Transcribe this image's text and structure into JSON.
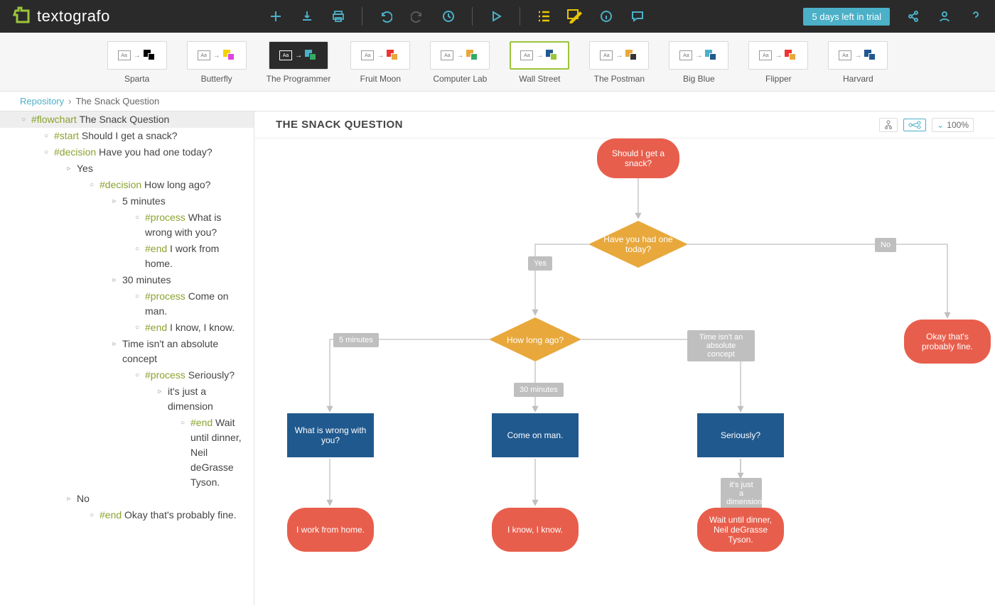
{
  "app": {
    "name": "textografo",
    "trial": "5 days left in trial"
  },
  "themes": [
    {
      "id": "sparta",
      "label": "Sparta"
    },
    {
      "id": "butterfly",
      "label": "Butterfly"
    },
    {
      "id": "programmer",
      "label": "The Programmer"
    },
    {
      "id": "fruitmoon",
      "label": "Fruit Moon"
    },
    {
      "id": "computerlab",
      "label": "Computer Lab"
    },
    {
      "id": "wallstreet",
      "label": "Wall Street",
      "selected": true
    },
    {
      "id": "postman",
      "label": "The Postman"
    },
    {
      "id": "bigblue",
      "label": "Big Blue"
    },
    {
      "id": "flipper",
      "label": "Flipper"
    },
    {
      "id": "harvard",
      "label": "Harvard"
    }
  ],
  "breadcrumb": {
    "root": "Repository",
    "current": "The Snack Question"
  },
  "canvas": {
    "title": "THE SNACK QUESTION",
    "zoom": "100%"
  },
  "tree": {
    "root": {
      "tag": "#flowchart",
      "text": "The Snack Question"
    },
    "lines": [
      {
        "indent": 1,
        "marker": "circle",
        "tag": "#start",
        "text": "Should I get a snack?"
      },
      {
        "indent": 1,
        "marker": "circle",
        "tag": "#decision",
        "text": "Have you had one today?"
      },
      {
        "indent": 2,
        "marker": "arrow",
        "text": "Yes"
      },
      {
        "indent": 3,
        "marker": "circle",
        "tag": "#decision",
        "text": "How long ago?"
      },
      {
        "indent": 4,
        "marker": "arrow",
        "text": "5 minutes"
      },
      {
        "indent": 5,
        "marker": "circle",
        "tag": "#process",
        "text": " What is wrong with you?"
      },
      {
        "indent": 5,
        "marker": "circle",
        "tag": "#end",
        "text": "I work from home."
      },
      {
        "indent": 4,
        "marker": "arrow",
        "text": "30 minutes"
      },
      {
        "indent": 5,
        "marker": "circle",
        "tag": "#process",
        "text": "Come on man."
      },
      {
        "indent": 5,
        "marker": "circle",
        "tag": "#end",
        "text": "I know, I know."
      },
      {
        "indent": 4,
        "marker": "arrow",
        "text": "Time isn't an absolute concept"
      },
      {
        "indent": 5,
        "marker": "circle",
        "tag": "#process",
        "text": "Seriously?"
      },
      {
        "indent": 6,
        "marker": "arrow",
        "text": "it's just a dimension"
      },
      {
        "indent": 7,
        "marker": "circle",
        "tag": "#end",
        "text": "Wait until dinner, Neil deGrasse Tyson."
      },
      {
        "indent": 2,
        "marker": "arrow",
        "text": "No"
      },
      {
        "indent": 3,
        "marker": "circle",
        "tag": "#end",
        "text": "Okay that's probably fine."
      }
    ]
  },
  "flow": {
    "start": "Should I get a snack?",
    "d1": "Have you had one today?",
    "d2": "How long ago?",
    "p1": "What is wrong with you?",
    "p2": "Come on man.",
    "p3": "Seriously?",
    "e1": "I work from home.",
    "e2": "I know, I know.",
    "e3": "Wait until dinner, Neil deGrasse Tyson.",
    "e4": "Okay that's probably fine.",
    "l_yes": "Yes",
    "l_no": "No",
    "l_5": "5 minutes",
    "l_30": "30 minutes",
    "l_time": "Time isn't an absolute concept",
    "l_dim": "it's just a dimension"
  }
}
